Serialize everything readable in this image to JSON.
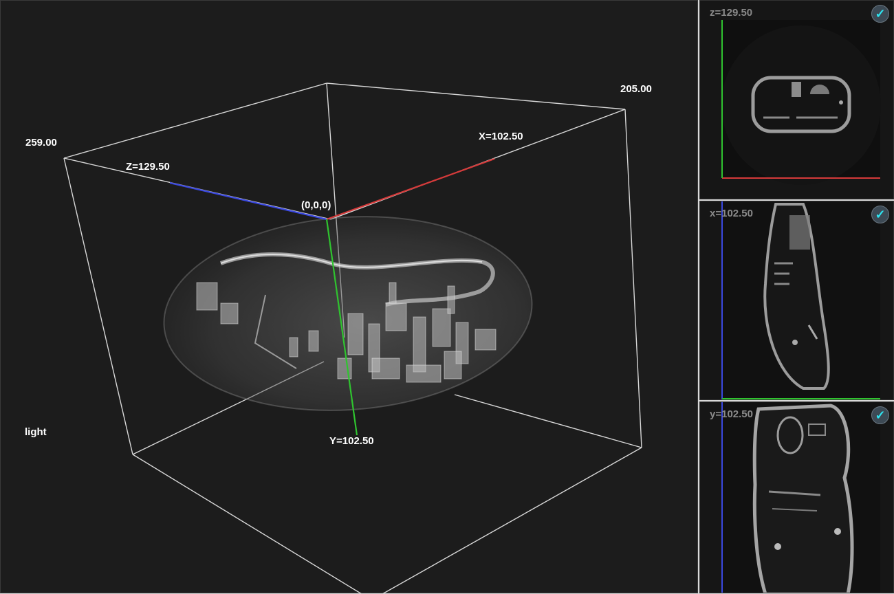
{
  "viewer": {
    "origin_label": "(0,0,0)",
    "x_axis_label": "X=102.50",
    "y_axis_label": "Y=102.50",
    "z_axis_label": "Z=129.50",
    "dim_right_label": "205.00",
    "dim_left_label": "259.00",
    "light_label": "light",
    "colors": {
      "x_axis": "#d63a3a",
      "y_axis": "#2fc42f",
      "z_axis": "#3a48e0",
      "bbox": "#d8d8d8",
      "background": "#1c1c1c"
    }
  },
  "slices": [
    {
      "label": "z=129.50",
      "checked": true,
      "check_glyph": "✓"
    },
    {
      "label": "x=102.50",
      "checked": true,
      "check_glyph": "✓"
    },
    {
      "label": "y=102.50",
      "checked": true,
      "check_glyph": "✓"
    }
  ]
}
